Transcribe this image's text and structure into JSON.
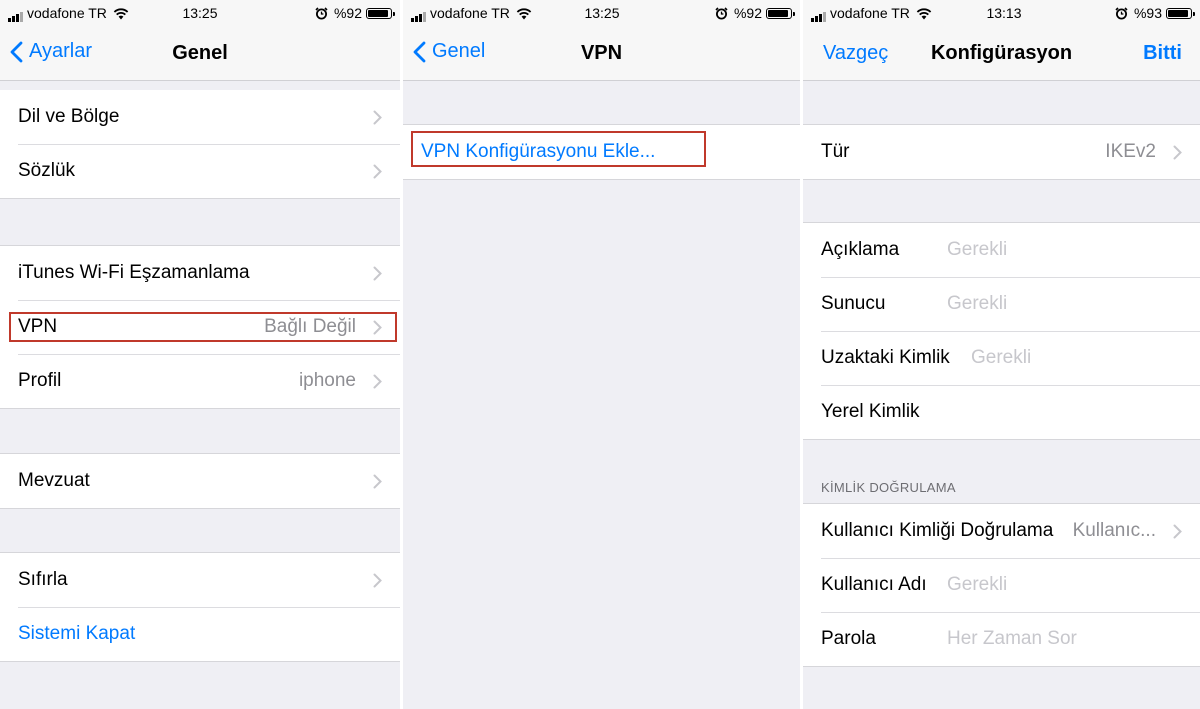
{
  "status_bar": [
    {
      "carrier": "vodafone TR",
      "time": "13:25",
      "battery": "%92",
      "battery_level": 0.92
    },
    {
      "carrier": "vodafone TR",
      "time": "13:25",
      "battery": "%92",
      "battery_level": 0.92
    },
    {
      "carrier": "vodafone TR",
      "time": "13:13",
      "battery": "%93",
      "battery_level": 0.93
    }
  ],
  "screen1": {
    "back_label": "Ayarlar",
    "title": "Genel",
    "items": [
      {
        "label": "Dil ve Bölge"
      },
      {
        "label": "Sözlük"
      },
      {
        "label": "iTunes Wi-Fi Eşzamanlama"
      },
      {
        "label": "VPN",
        "value": "Bağlı Değil"
      },
      {
        "label": "Profil",
        "value": "iphone"
      },
      {
        "label": "Mevzuat"
      },
      {
        "label": "Sıfırla"
      },
      {
        "label": "Sistemi Kapat"
      }
    ]
  },
  "screen2": {
    "back_label": "Genel",
    "title": "VPN",
    "add_config": "VPN Konfigürasyonu Ekle..."
  },
  "screen3": {
    "cancel_label": "Vazgeç",
    "title": "Konfigürasyon",
    "done_label": "Bitti",
    "type_label": "Tür",
    "type_value": "IKEv2",
    "fields": [
      {
        "label": "Açıklama",
        "placeholder": "Gerekli"
      },
      {
        "label": "Sunucu",
        "placeholder": "Gerekli"
      },
      {
        "label": "Uzaktaki Kimlik",
        "placeholder": "Gerekli"
      },
      {
        "label": "Yerel Kimlik",
        "placeholder": ""
      }
    ],
    "auth_header": "KİMLİK DOĞRULAMA",
    "auth_method_label": "Kullanıcı Kimliği Doğrulama",
    "auth_method_value": "Kullanıc...",
    "username_label": "Kullanıcı Adı",
    "username_placeholder": "Gerekli",
    "password_label": "Parola",
    "password_placeholder": "Her Zaman Sor"
  },
  "colors": {
    "accent": "#007aff",
    "highlight": "#c0392b",
    "background": "#efeff4"
  }
}
